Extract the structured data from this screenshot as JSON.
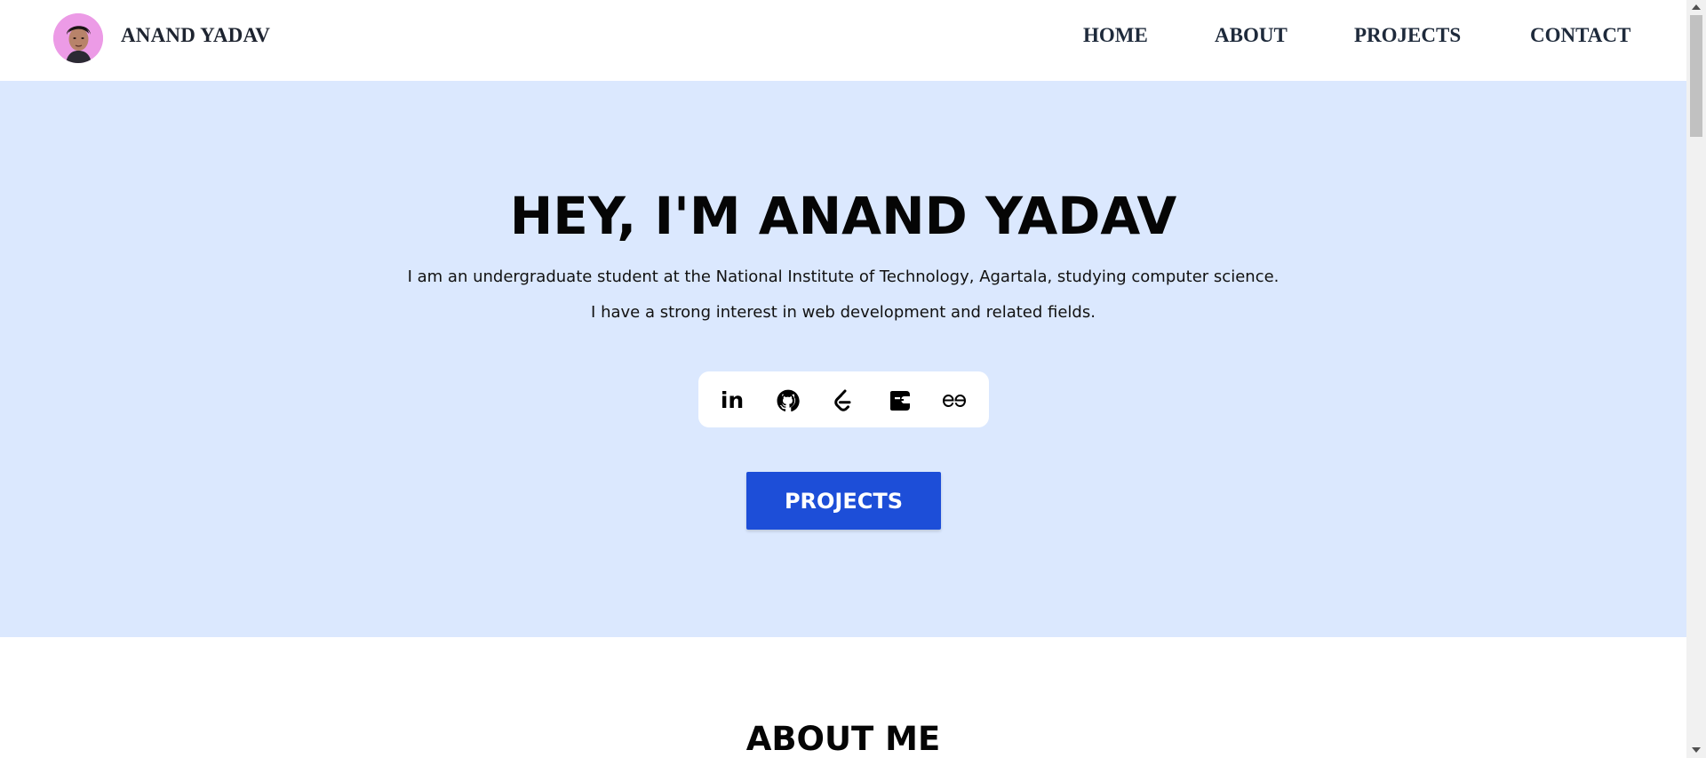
{
  "navbar": {
    "brand": "ANAND YADAV",
    "links": [
      "HOME",
      "ABOUT",
      "PROJECTS",
      "CONTACT"
    ]
  },
  "hero": {
    "title": "HEY, I'M ANAND YADAV",
    "line1": "I am an undergraduate student at the National Institute of Technology, Agartala, studying computer science.",
    "line2": "I have a strong interest in web development and related fields.",
    "social_icons": [
      "linkedin-icon",
      "github-icon",
      "leetcode-icon",
      "codechef-icon",
      "geeksforgeeks-icon"
    ],
    "linkedin_glyph": "in",
    "cta_label": "PROJECTS"
  },
  "about": {
    "title": "ABOUT ME"
  },
  "colors": {
    "hero_bg": "#dbe8fe",
    "cta_bg": "#1d4ed8",
    "avatar_bg": "#ec9be6",
    "nav_text": "#1e2a3b"
  }
}
